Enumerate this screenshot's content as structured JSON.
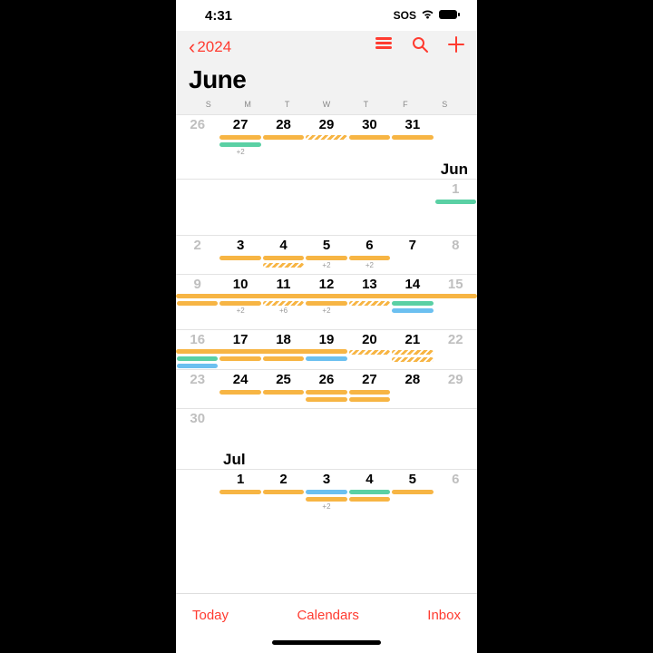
{
  "status": {
    "time": "4:31",
    "sos": "SOS"
  },
  "nav": {
    "year": "2024"
  },
  "title": "June",
  "dow": [
    "S",
    "M",
    "T",
    "W",
    "T",
    "F",
    "S"
  ],
  "month2": "Jun",
  "month3": "Jul",
  "toolbar": {
    "today": "Today",
    "calendars": "Calendars",
    "inbox": "Inbox"
  },
  "days": {
    "w1": [
      "26",
      "27",
      "28",
      "29",
      "30",
      "31",
      ""
    ],
    "w1b": [
      "",
      "",
      "",
      "",
      "",
      "",
      "1"
    ],
    "w2": [
      "2",
      "3",
      "4",
      "5",
      "6",
      "7",
      "8"
    ],
    "w3": [
      "9",
      "10",
      "11",
      "12",
      "13",
      "14",
      "15"
    ],
    "w4": [
      "16",
      "17",
      "18",
      "19",
      "20",
      "21",
      "22"
    ],
    "w5": [
      "23",
      "24",
      "25",
      "26",
      "27",
      "28",
      "29"
    ],
    "w6": [
      "30",
      "",
      "",
      "",
      "",
      "",
      ""
    ],
    "w7": [
      "",
      "1",
      "2",
      "3",
      "4",
      "5",
      "6"
    ]
  },
  "more": {
    "p2": "+2",
    "p6": "+6"
  }
}
